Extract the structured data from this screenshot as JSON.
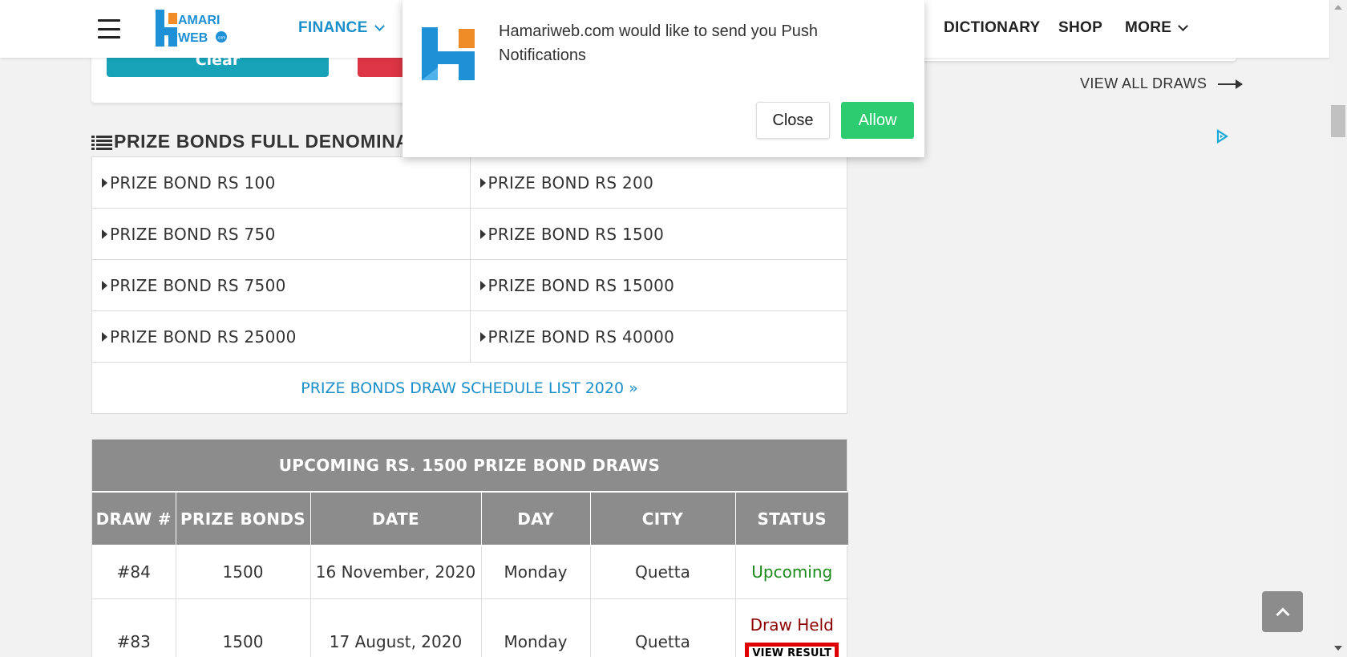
{
  "header": {
    "logo_text_top": "AMARI",
    "logo_text_bottom": "WEB",
    "logo_text_dot": ".com",
    "nav_finance": "FINANCE",
    "nav_dictionary": "DICTIONARY",
    "nav_shop": "SHOP",
    "nav_more": "MORE"
  },
  "top_card": {
    "clear_label": "Clear"
  },
  "sidebar": {
    "view_all_draws": "VIEW ALL DRAWS"
  },
  "section": {
    "title": "PRIZE BONDS FULL DENOMINA",
    "denominations": [
      [
        "PRIZE BOND RS 100",
        "PRIZE BOND RS 200"
      ],
      [
        "PRIZE BOND RS 750",
        "PRIZE BOND RS 1500"
      ],
      [
        "PRIZE BOND RS 7500",
        "PRIZE BOND RS 15000"
      ],
      [
        "PRIZE BOND RS 25000",
        "PRIZE BOND RS 40000"
      ]
    ],
    "schedule_link": "PRIZE BONDS DRAW SCHEDULE LIST 2020 »"
  },
  "draws": {
    "title": "UPCOMING RS. 1500 PRIZE BOND DRAWS",
    "columns": [
      "DRAW #",
      "PRIZE BONDS",
      "DATE",
      "DAY",
      "CITY",
      "STATUS"
    ],
    "rows": [
      {
        "draw": "#84",
        "bond": "1500",
        "date": "16 November, 2020",
        "day": "Monday",
        "city": "Quetta",
        "status": "Upcoming",
        "action": ""
      },
      {
        "draw": "#83",
        "bond": "1500",
        "date": "17 August, 2020",
        "day": "Monday",
        "city": "Quetta",
        "status": "Draw Held",
        "action": "VIEW RESULT"
      }
    ]
  },
  "popup": {
    "message": "Hamariweb.com would like to send you Push Notifications",
    "close_label": "Close",
    "allow_label": "Allow"
  },
  "colors": {
    "brand_blue": "#1a8fc9",
    "teal": "#17a2b8",
    "red": "#dc3545",
    "table_header": "#8c8c8c",
    "upcoming_green": "#1a8a1a",
    "held_red": "#8b0000",
    "allow_green": "#2ecc71"
  },
  "icons": {
    "menu": "hamburger-icon",
    "finance_dropdown": "chevron-down-icon",
    "more_dropdown": "chevron-down-icon",
    "view_all": "arrow-right-icon",
    "ad": "adchoices-icon",
    "section": "list-icon",
    "denomination_bullet": "caret-right-icon",
    "schedule": "double-chevron-right-icon",
    "back_to_top": "chevron-up-icon"
  }
}
